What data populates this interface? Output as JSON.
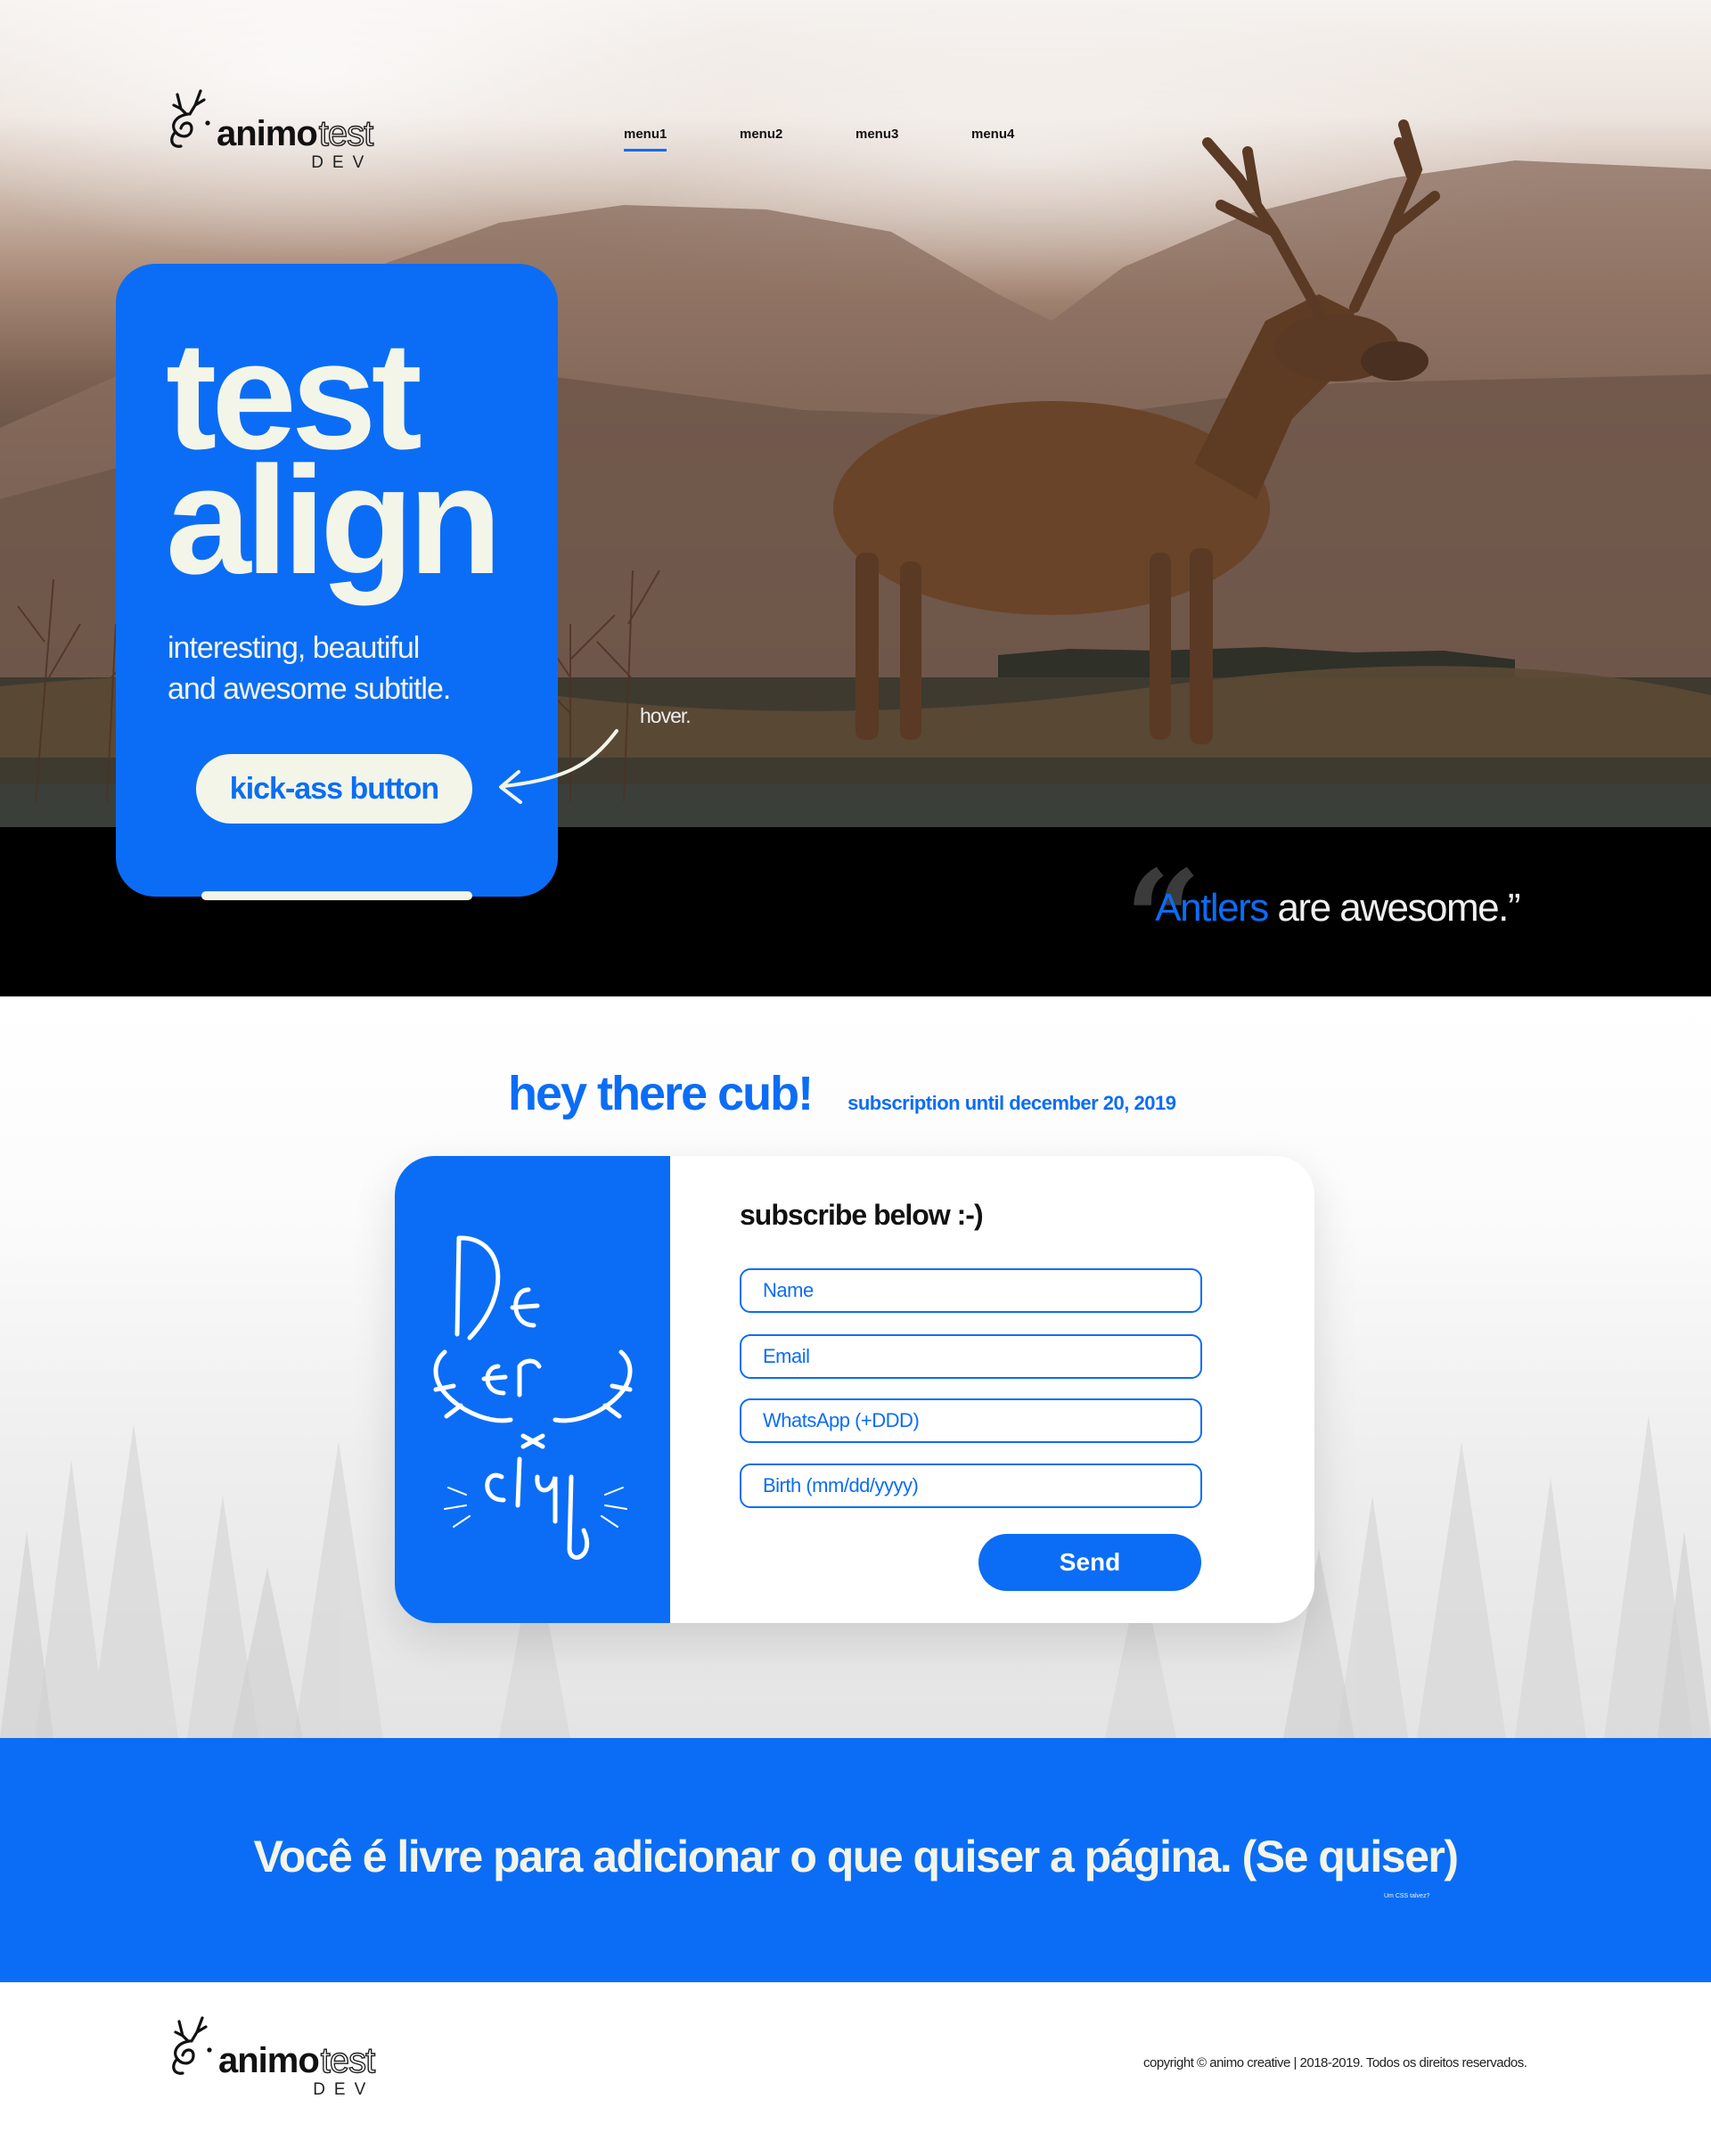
{
  "brand": {
    "name_bold": "animo",
    "name_outline": "test",
    "sub": "DEV"
  },
  "nav": {
    "items": [
      {
        "label": "menu1",
        "active": true
      },
      {
        "label": "menu2",
        "active": false
      },
      {
        "label": "menu3",
        "active": false
      },
      {
        "label": "menu4",
        "active": false
      }
    ]
  },
  "hero": {
    "title_line1": "test",
    "title_line2": "align",
    "subtitle_line1": "interesting, beautiful",
    "subtitle_line2": "and awesome subtitle.",
    "cta_label": "kick-ass button",
    "hover_note": "hover."
  },
  "quote": {
    "mark": "“",
    "accent": "Antlers",
    "rest": " are awesome.”"
  },
  "subscribe": {
    "heading": "hey there cub!",
    "note": "subscription until december 20, 2019",
    "form_title": "subscribe below :-)",
    "art_text": "Deer club",
    "fields": {
      "name_placeholder": "Name",
      "email_placeholder": "Email",
      "whatsapp_placeholder": "WhatsApp (+DDD)",
      "birth_placeholder": "Birth (mm/dd/yyyy)"
    },
    "send_label": "Send"
  },
  "banner": {
    "message": "Você é livre para adicionar o que quiser a página. (Se quiser)",
    "tiny_note": "Um CSS talvez?"
  },
  "footer": {
    "copyright": "copyright © animo creative | 2018-2019. Todos os direitos reservados."
  },
  "colors": {
    "accent": "#0b6df5",
    "cream": "#f3f5e9",
    "band": "#000000"
  },
  "icons": [
    "deer-logo-icon",
    "arrow-icon",
    "quote-mark-icon",
    "deer-club-illustration"
  ]
}
